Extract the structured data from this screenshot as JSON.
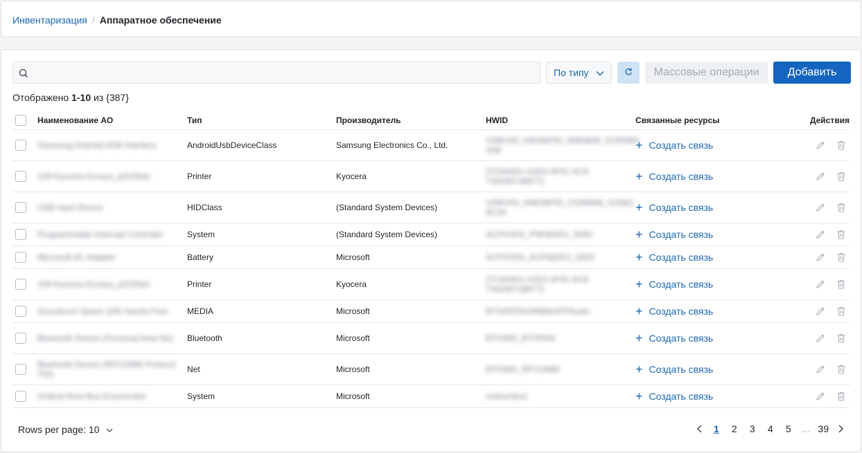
{
  "breadcrumb": {
    "root": "Инвентаризация",
    "separator": "/",
    "current": "Аппаратное обеспечение"
  },
  "toolbar": {
    "search_placeholder": "",
    "type_filter": "По типу",
    "mass_ops": "Массовые операции",
    "add": "Добавить"
  },
  "count": {
    "prefix": "Отображено",
    "range": "1-10",
    "of": "из",
    "total": "{387}"
  },
  "columns": {
    "name": "Наименование АО",
    "type": "Тип",
    "vendor": "Производитель",
    "hwid": "HWID",
    "links": "Связанные ресурсы",
    "actions": "Действия"
  },
  "create_link_label": "Создать связь",
  "rows": [
    {
      "name": "Samsung Android ADB Interface",
      "type": "AndroidUsbDeviceClass",
      "vendor": "Samsung Electronics Co., Ltd.",
      "hwid": "USB\\VID_04E8&PID_6860&MI_01\\R58M 2AB"
    },
    {
      "name": "109 Kyocera Ecosys_p3155dn",
      "type": "Printer",
      "vendor": "Kyocera",
      "hwid": "{7C5A4D1-A2E0-4F81-AC8 73ADEF1B877}"
    },
    {
      "name": "USB Input Device",
      "type": "HIDClass",
      "vendor": "(Standard System Devices)",
      "hwid": "USB\\VID_046D&PID_C52B&MI_01\\6&1 8C2A"
    },
    {
      "name": "Programmable Interrupt Controller",
      "type": "System",
      "vendor": "(Standard System Devices)",
      "hwid": "ACPI\\VEN_PNP&DEV_0000"
    },
    {
      "name": "Microsoft AC Adapter",
      "type": "Battery",
      "vendor": "Microsoft",
      "hwid": "ACPI\\VEN_ACPI&DEV_0003"
    },
    {
      "name": "109 Kyocera Ecosys_p3155dn",
      "type": "Printer",
      "vendor": "Kyocera",
      "hwid": "{7C5A4D1-A2E0-4F81-AC8 73ADEF1B877}"
    },
    {
      "name": "Soundcore Space Q45 Hands-Free",
      "type": "MEDIA",
      "vendor": "Microsoft",
      "hwid": "BTHHFENUM\\BthHFPAudio"
    },
    {
      "name": "Bluetooth Device (Personal Area Ne)",
      "type": "Bluetooth",
      "vendor": "Microsoft",
      "hwid": "BTH\\MS_BTHPAN"
    },
    {
      "name": "Bluetooth Device (RFCOMM Protocol TDI)",
      "type": "Net",
      "vendor": "Microsoft",
      "hwid": "BTH\\MS_RFCOMM"
    },
    {
      "name": "Ordinal Root Bus Enumerator",
      "type": "System",
      "vendor": "Microsoft",
      "hwid": "root\\umbus"
    }
  ],
  "footer": {
    "rows_per_page": "Rows per page: 10",
    "pages": [
      "1",
      "2",
      "3",
      "4",
      "5"
    ],
    "ellipsis": "...",
    "last_page": "39",
    "current_page": 1
  },
  "colors": {
    "accent": "#1d67b3",
    "primary_button": "#1565c0",
    "refresh_bg": "#cfe3f7",
    "border": "#e3e6ea"
  }
}
